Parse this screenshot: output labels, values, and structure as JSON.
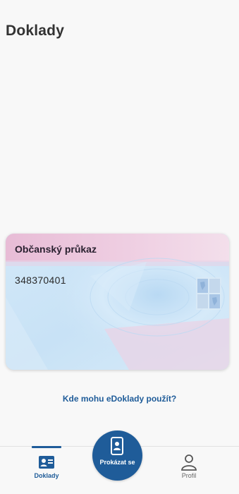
{
  "header": {
    "title": "Doklady"
  },
  "card": {
    "title": "Občanský průkaz",
    "number": "348370401"
  },
  "help_link": "Kde mohu eDoklady použít?",
  "bottom_nav": {
    "items": [
      {
        "label": "Doklady",
        "icon": "id-card-icon",
        "active": true
      },
      {
        "label": "Prokázat se",
        "icon": "phone-id-icon"
      },
      {
        "label": "Profil",
        "icon": "person-icon"
      }
    ]
  },
  "colors": {
    "accent": "#1f5c99",
    "card_pink": "#ecc3d9",
    "card_blue": "#cfe6f8",
    "background": "#f8f8f8"
  }
}
